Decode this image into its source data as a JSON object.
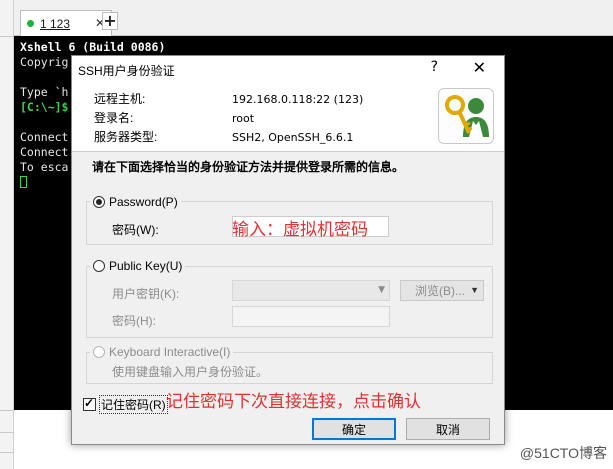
{
  "tabbar": {
    "tab_label": "1 123",
    "close_glyph": "✕",
    "add_glyph": "+"
  },
  "terminal": {
    "lines": [
      "Xshell 6 (Build 0086)",
      "Copyrig",
      "",
      "Type `h",
      "[C:\\~]$",
      "",
      "Connect",
      "Connect",
      "To esca"
    ]
  },
  "dialog": {
    "title": "SSH用户身份验证",
    "help_glyph": "?",
    "close_glyph": "✕",
    "info": {
      "host_label": "远程主机:",
      "host_value": "192.168.0.118:22 (123)",
      "login_label": "登录名:",
      "login_value": "root",
      "server_type_label": "服务器类型:",
      "server_type_value": "SSH2, OpenSSH_6.6.1"
    },
    "instruction": "请在下面选择恰当的身份验证方法并提供登录所需的信息。",
    "password_group": {
      "radio_label": "Password(P)",
      "field_label": "密码(W):",
      "checked": true
    },
    "pubkey_group": {
      "radio_label": "Public Key(U)",
      "user_key_label": "用户密钥(K):",
      "password_label": "密码(H):",
      "browse_label": "浏览(B)..."
    },
    "keyboard_group": {
      "radio_label": "Keyboard Interactive(I)",
      "hint": "使用键盘输入用户身份验证。"
    },
    "remember_label": "记住密码(R)",
    "ok_label": "确定",
    "cancel_label": "取消"
  },
  "annotations": {
    "password_hint": "输入：虚拟机密码",
    "remember_hint": "记住密码下次直接连接，点击确认"
  },
  "watermark": "@51CTO博客",
  "colors": {
    "annotation_red": "#e53030",
    "terminal_green": "#39d353",
    "primary_border": "#0078d7"
  }
}
